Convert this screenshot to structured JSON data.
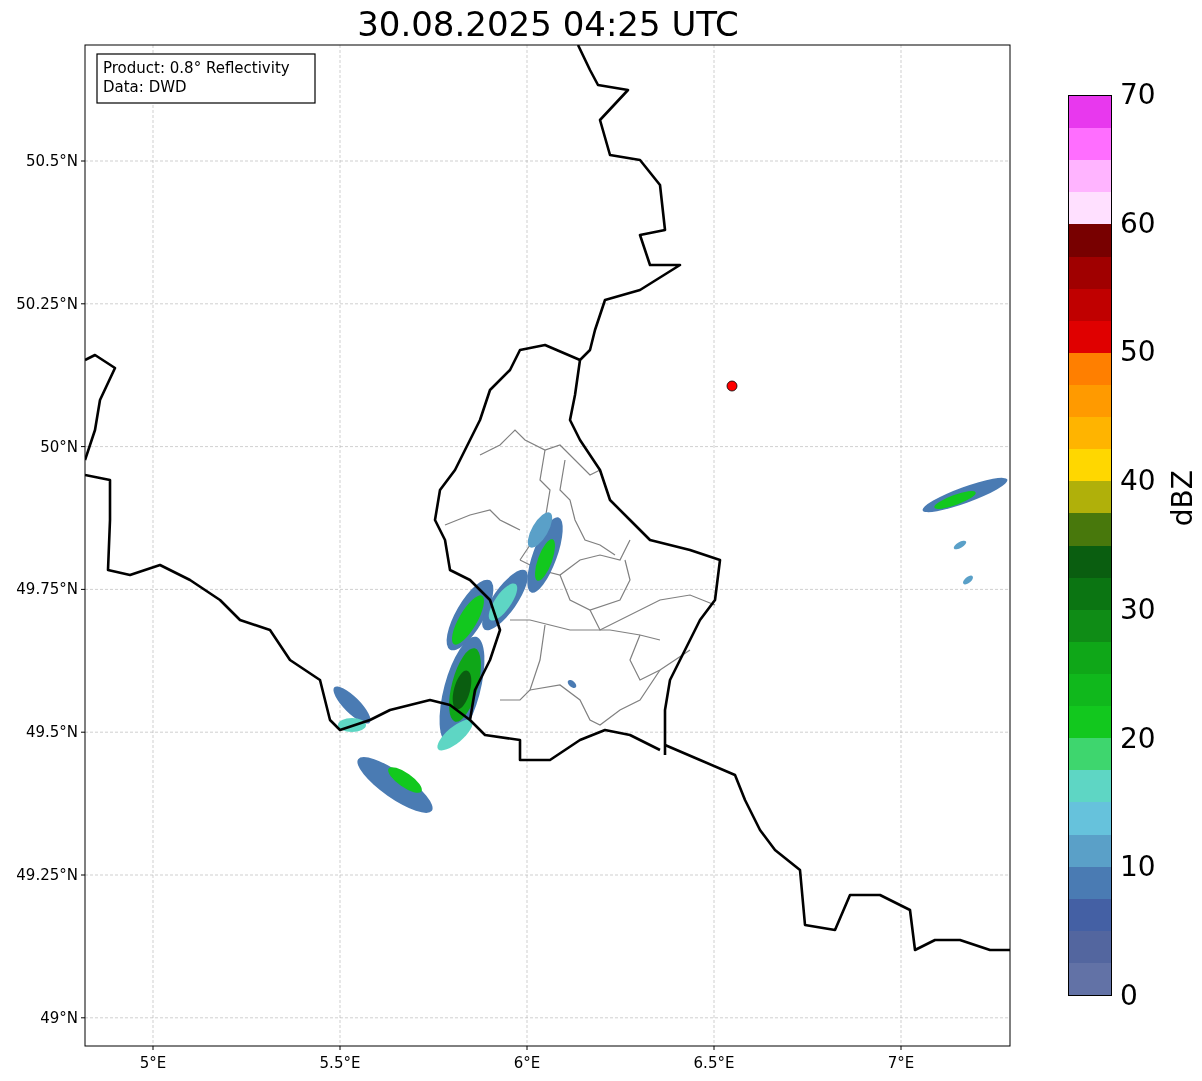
{
  "title": "30.08.2025 04:25 UTC",
  "info_box": {
    "lines": [
      "Product: 0.8° Reflectivity",
      "Data: DWD"
    ]
  },
  "map": {
    "y_ticks": [
      "50.5°N",
      "50.25°N",
      "50°N",
      "49.75°N",
      "49.5°N",
      "49.25°N",
      "49°N"
    ],
    "x_ticks": [
      "5°E",
      "5.5°E",
      "6°E",
      "6.5°E",
      "7°E"
    ]
  },
  "colorbar": {
    "label": "dBZ",
    "ticks": [
      "70",
      "60",
      "50",
      "40",
      "30",
      "20",
      "10",
      "0"
    ],
    "segments": [
      {
        "color": "#e838ee"
      },
      {
        "color": "#ff6eff"
      },
      {
        "color": "#ffb4ff"
      },
      {
        "color": "#ffe0ff"
      },
      {
        "color": "#780000"
      },
      {
        "color": "#a00000"
      },
      {
        "color": "#c00000"
      },
      {
        "color": "#e00000"
      },
      {
        "color": "#ff7f00"
      },
      {
        "color": "#ff9a00"
      },
      {
        "color": "#ffb400"
      },
      {
        "color": "#ffd700"
      },
      {
        "color": "#b0b00a"
      },
      {
        "color": "#48780c"
      },
      {
        "color": "#0a5e10"
      },
      {
        "color": "#0b7512"
      },
      {
        "color": "#0f8c16"
      },
      {
        "color": "#0fa718"
      },
      {
        "color": "#10b81c"
      },
      {
        "color": "#12c81e"
      },
      {
        "color": "#3ed66e"
      },
      {
        "color": "#5ed6c4"
      },
      {
        "color": "#66c2dc"
      },
      {
        "color": "#5aa0c8"
      },
      {
        "color": "#4a7bb3"
      },
      {
        "color": "#4460a4"
      },
      {
        "color": "#53669f"
      },
      {
        "color": "#6272a6"
      }
    ]
  }
}
